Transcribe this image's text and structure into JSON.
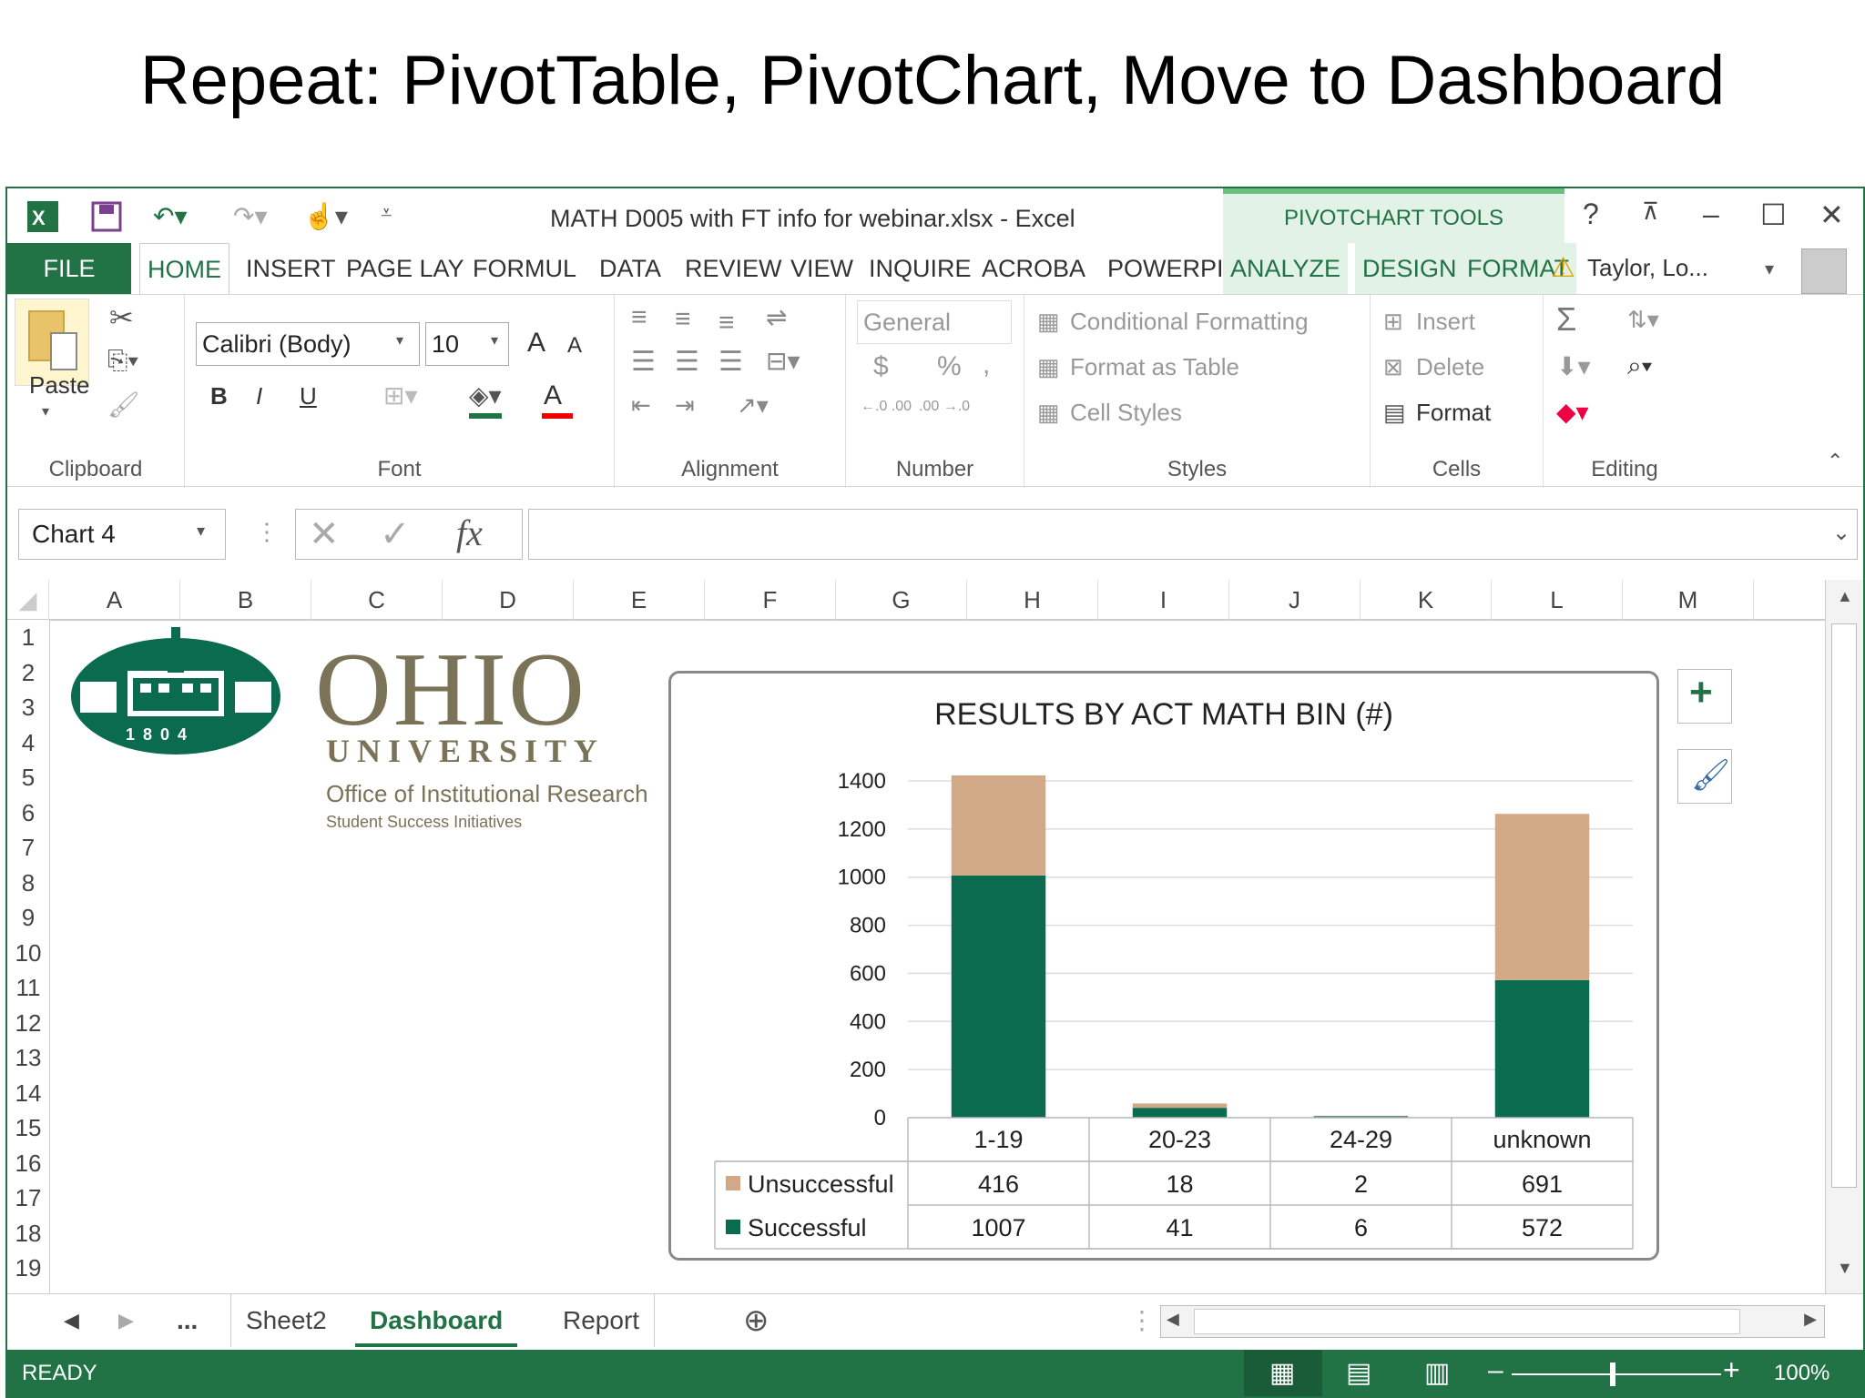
{
  "slide": {
    "title": "Repeat: PivotTable, PivotChart, Move to Dashboard"
  },
  "window": {
    "title": "MATH D005 with FT info for webinar.xlsx - Excel",
    "context_tools": "PIVOTCHART TOOLS",
    "help": "?",
    "user": "Taylor, Lo..."
  },
  "tabs": [
    {
      "label": "FILE"
    },
    {
      "label": "HOME"
    },
    {
      "label": "INSERT"
    },
    {
      "label": "PAGE LAY"
    },
    {
      "label": "FORMUL"
    },
    {
      "label": "DATA"
    },
    {
      "label": "REVIEW"
    },
    {
      "label": "VIEW"
    },
    {
      "label": "INQUIRE"
    },
    {
      "label": "ACROBA"
    },
    {
      "label": "POWERPI"
    },
    {
      "label": "ANALYZE"
    },
    {
      "label": "DESIGN"
    },
    {
      "label": "FORMAT"
    }
  ],
  "ribbon": {
    "clipboard": {
      "label": "Clipboard",
      "paste": "Paste"
    },
    "font": {
      "label": "Font",
      "name": "Calibri (Body)",
      "size": "10",
      "bold": "B",
      "italic": "I",
      "underline": "U",
      "grow": "A",
      "shrink": "A",
      "color": "A"
    },
    "alignment": {
      "label": "Alignment"
    },
    "number": {
      "label": "Number",
      "format": "General",
      "currency": "$",
      "percent": "%",
      "comma": ",",
      "inc_decimal": "←.0 .00",
      "dec_decimal": ".00 →.0"
    },
    "styles": {
      "label": "Styles",
      "cond": "Conditional Formatting",
      "table": "Format as Table",
      "cell": "Cell Styles"
    },
    "cells": {
      "label": "Cells",
      "insert": "Insert",
      "delete": "Delete",
      "format": "Format"
    },
    "editing": {
      "label": "Editing",
      "sum": "Σ"
    }
  },
  "formula_bar": {
    "name_box": "Chart 4",
    "fx": "fx",
    "value": ""
  },
  "columns": [
    "A",
    "B",
    "C",
    "D",
    "E",
    "F",
    "G",
    "H",
    "I",
    "J",
    "K",
    "L",
    "M"
  ],
  "rows": [
    "1",
    "2",
    "3",
    "4",
    "5",
    "6",
    "7",
    "8",
    "9",
    "10",
    "11",
    "12",
    "13",
    "14",
    "15",
    "16",
    "17",
    "18",
    "19"
  ],
  "logo": {
    "word": "OHIO",
    "university": "UNIVERSITY",
    "office": "Office of Institutional Research",
    "sub": "Student Success Initiatives",
    "seal_year": "1 8 0 4"
  },
  "chart_data": {
    "type": "bar",
    "stacked": true,
    "title": "RESULTS BY ACT MATH BIN (#)",
    "categories": [
      "1-19",
      "20-23",
      "24-29",
      "unknown"
    ],
    "series": [
      {
        "name": "Successful",
        "values": [
          1007,
          41,
          6,
          572
        ],
        "color": "#0b6b4e"
      },
      {
        "name": "Unsuccessful",
        "values": [
          416,
          18,
          2,
          691
        ],
        "color": "#d2a986"
      }
    ],
    "ylim": [
      0,
      1400
    ],
    "yticks": [
      "0",
      "200",
      "400",
      "600",
      "800",
      "1000",
      "1200",
      "1400"
    ],
    "grid": true,
    "data_table": true
  },
  "sheet_tabs": {
    "more": "...",
    "tabs": [
      "Sheet2",
      "Dashboard",
      "Report"
    ],
    "active": "Dashboard"
  },
  "status": {
    "mode": "READY",
    "zoom": "100%"
  },
  "colors": {
    "accent": "#217346",
    "context": "#e3f2e6"
  }
}
